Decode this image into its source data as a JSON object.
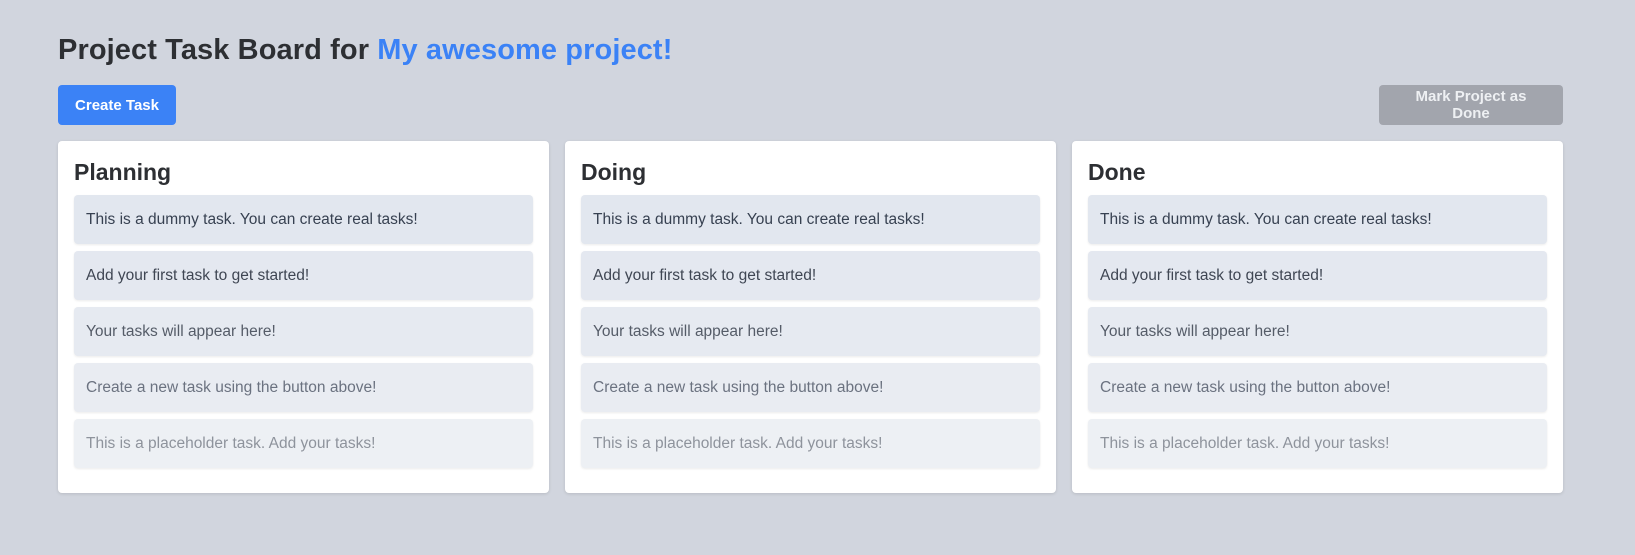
{
  "header": {
    "title_prefix": "Project Task Board for ",
    "project_name": "My awesome project!"
  },
  "actions": {
    "create_task_label": "Create Task",
    "mark_done_label": "Mark Project as Done"
  },
  "colors": {
    "accent": "#3b82f6",
    "background": "#d1d5de",
    "disabled_button": "#a2a5ad",
    "card": "#ffffff",
    "task_bg": "#e5e9f0"
  },
  "columns": [
    {
      "title": "Planning",
      "tasks": [
        "This is a dummy task. You can create real tasks!",
        "Add your first task to get started!",
        "Your tasks will appear here!",
        "Create a new task using the button above!",
        "This is a placeholder task. Add your tasks!"
      ]
    },
    {
      "title": "Doing",
      "tasks": [
        "This is a dummy task. You can create real tasks!",
        "Add your first task to get started!",
        "Your tasks will appear here!",
        "Create a new task using the button above!",
        "This is a placeholder task. Add your tasks!"
      ]
    },
    {
      "title": "Done",
      "tasks": [
        "This is a dummy task. You can create real tasks!",
        "Add your first task to get started!",
        "Your tasks will appear here!",
        "Create a new task using the button above!",
        "This is a placeholder task. Add your tasks!"
      ]
    }
  ]
}
